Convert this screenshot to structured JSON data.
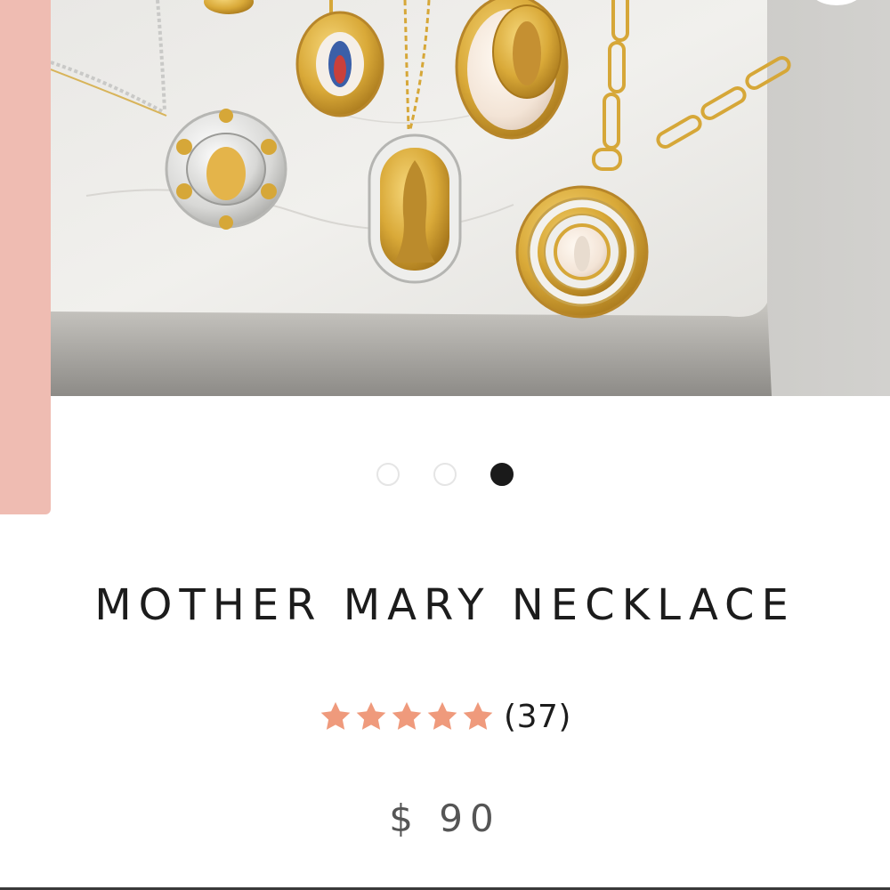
{
  "product": {
    "title": "MOTHER MARY NECKLACE",
    "rating_count": "(37)",
    "rating_value": 5,
    "rating_max": 5,
    "price": "$ 90"
  },
  "gallery": {
    "image_description_icon": "product-photo",
    "slide_count": 3,
    "active_slide": 3
  },
  "colors": {
    "accent_pink": "#efbcb2",
    "star": "#ef9a7c",
    "title": "#1c1c1c",
    "price": "#555555"
  }
}
